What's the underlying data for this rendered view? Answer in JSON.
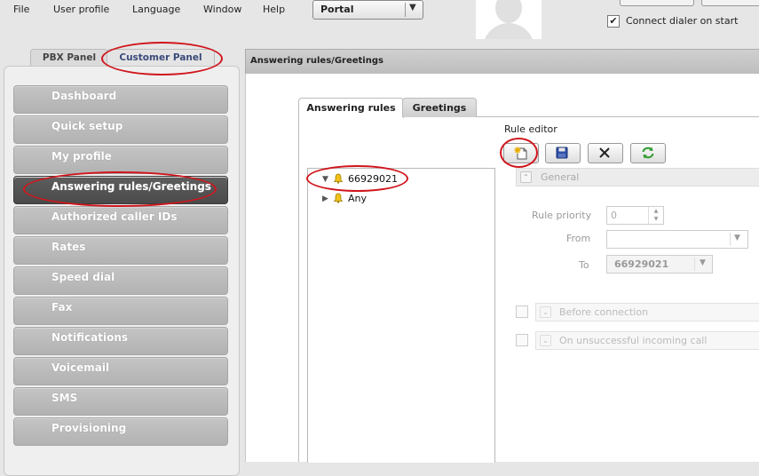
{
  "menu": {
    "items": [
      "File",
      "User profile",
      "Language",
      "Window",
      "Help"
    ],
    "portal_select": "Portal"
  },
  "header": {
    "connect_dialer_label": "Connect dialer on start",
    "connect_dialer_checked": true
  },
  "panel_tabs": [
    "PBX Panel",
    "Customer Panel"
  ],
  "sidebar": {
    "items": [
      {
        "label": "Dashboard"
      },
      {
        "label": "Quick setup"
      },
      {
        "label": "My profile"
      },
      {
        "label": "Answering rules/Greetings",
        "active": true
      },
      {
        "label": "Authorized caller IDs"
      },
      {
        "label": "Rates"
      },
      {
        "label": "Speed dial"
      },
      {
        "label": "Fax"
      },
      {
        "label": "Notifications"
      },
      {
        "label": "Voicemail"
      },
      {
        "label": "SMS"
      },
      {
        "label": "Provisioning"
      }
    ]
  },
  "main": {
    "title": "Answering rules/Greetings",
    "tabs": [
      "Answering rules",
      "Greetings"
    ],
    "tree": {
      "root": "66929021",
      "child": "Any"
    },
    "rule_editor": {
      "label": "Rule editor",
      "toolbar_icons": [
        "new-rule-icon",
        "save-icon",
        "delete-icon",
        "refresh-icon"
      ],
      "general_section": "General",
      "rule_priority_label": "Rule priority",
      "rule_priority_value": "0",
      "from_label": "From",
      "from_value": "",
      "to_label": "To",
      "to_value": "66929021",
      "before_connection_label": "Before connection",
      "unsuccessful_call_label": "On unsuccessful incoming call"
    }
  },
  "colors": {
    "annotation_red": "#d0161c",
    "active_nav": "#505050",
    "nav_button": "#bcbcbc"
  }
}
